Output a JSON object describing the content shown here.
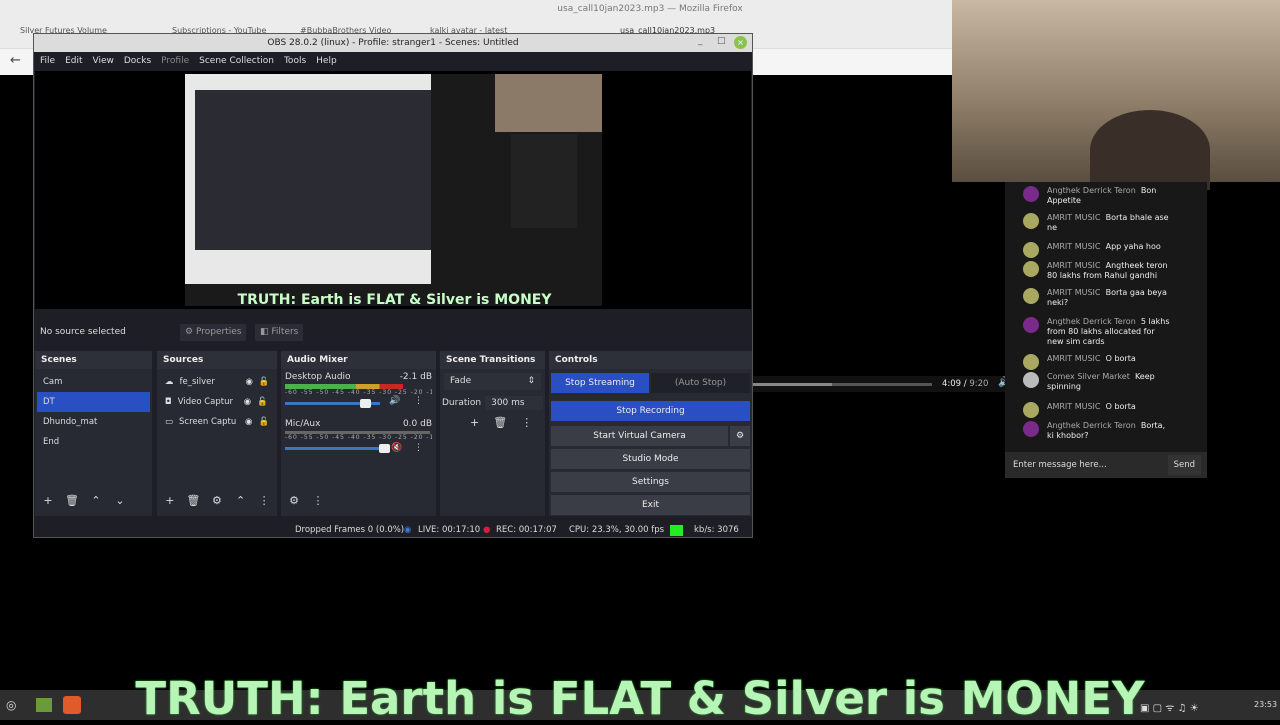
{
  "firefox": {
    "title": "usa_call10jan2023.mp3 — Mozilla Firefox",
    "tabs": [
      "Silver Futures Volume",
      "Subscriptions - YouTube",
      "#BubbaBrothers Video",
      "kalki avatar - latest",
      "usa_call10jan2023.mp3"
    ]
  },
  "obs": {
    "title": "OBS 28.0.2 (linux) - Profile: stranger1 - Scenes: Untitled",
    "menu": [
      "File",
      "Edit",
      "View",
      "Docks",
      "Profile",
      "Scene Collection",
      "Tools",
      "Help"
    ],
    "preview_banner": "TRUTH: Earth is FLAT  & Silver is MONEY",
    "source_bar": {
      "label": "No source selected",
      "properties": "Properties",
      "filters": "Filters"
    },
    "scenes": {
      "title": "Scenes",
      "items": [
        "Cam",
        "DT",
        "Dhundo_mat",
        "End"
      ],
      "selected": "DT"
    },
    "sources": {
      "title": "Sources",
      "items": [
        "fe_silver",
        "Video Captur",
        "Screen Captu"
      ]
    },
    "mixer": {
      "title": "Audio Mixer",
      "ticks": "-60 -55 -50 -45 -40 -35 -30 -25 -20 -15 -10 -5 0",
      "channels": [
        {
          "name": "Desktop Audio",
          "db": "-2.1 dB",
          "volume": 0.9
        },
        {
          "name": "Mic/Aux",
          "db": "0.0 dB",
          "volume": 1.0
        }
      ]
    },
    "transitions": {
      "title": "Scene Transitions",
      "type": "Fade",
      "duration_label": "Duration",
      "duration": "300 ms"
    },
    "controls": {
      "title": "Controls",
      "stop_streaming": "Stop Streaming",
      "auto_stop": "(Auto Stop)",
      "stop_recording": "Stop Recording",
      "virtual_camera": "Start Virtual Camera",
      "studio_mode": "Studio Mode",
      "settings": "Settings",
      "exit": "Exit"
    },
    "status": {
      "dropped": "Dropped Frames 0 (0.0%)",
      "live": "LIVE: 00:17:10",
      "rec": "REC: 00:17:07",
      "cpu": "CPU: 23.3%, 30.00 fps",
      "kbps": "kb/s: 3076"
    }
  },
  "player": {
    "time": "4:09",
    "duration": "9:20",
    "progress": 0.445
  },
  "chat": {
    "messages": [
      {
        "author": "Angthek Derrick Teron",
        "text": "Bon Appetite",
        "color": "#7a2a8a"
      },
      {
        "author": "AMRIT MUSIC",
        "text": "Borta bhale ase ne",
        "color": "#a8a860"
      },
      {
        "author": "AMRIT MUSIC",
        "text": "App yaha hoo",
        "color": "#a8a860"
      },
      {
        "author": "AMRIT MUSIC",
        "text": "Angtheek teron 80 lakhs from Rahul gandhi",
        "color": "#a8a860"
      },
      {
        "author": "AMRIT MUSIC",
        "text": "Borta gaa beya neki?",
        "color": "#a8a860"
      },
      {
        "author": "Angthek Derrick Teron",
        "text": "5 lakhs from 80 lakhs allocated for new sim cards",
        "color": "#7a2a8a"
      },
      {
        "author": "AMRIT MUSIC",
        "text": "O borta",
        "color": "#a8a860"
      },
      {
        "author": "Comex Silver Market",
        "text": "Keep spinning",
        "color": "#bbbbbb"
      },
      {
        "author": "AMRIT MUSIC",
        "text": "O borta",
        "color": "#a8a860"
      },
      {
        "author": "Angthek Derrick Teron",
        "text": "Borta, ki khobor?",
        "color": "#7a2a8a"
      }
    ],
    "placeholder": "Enter message here...",
    "send": "Send"
  },
  "overlay_banner": "TRUTH: Earth is FLAT  & Silver is MONEY",
  "taskbar": {
    "clock": "23:53"
  }
}
